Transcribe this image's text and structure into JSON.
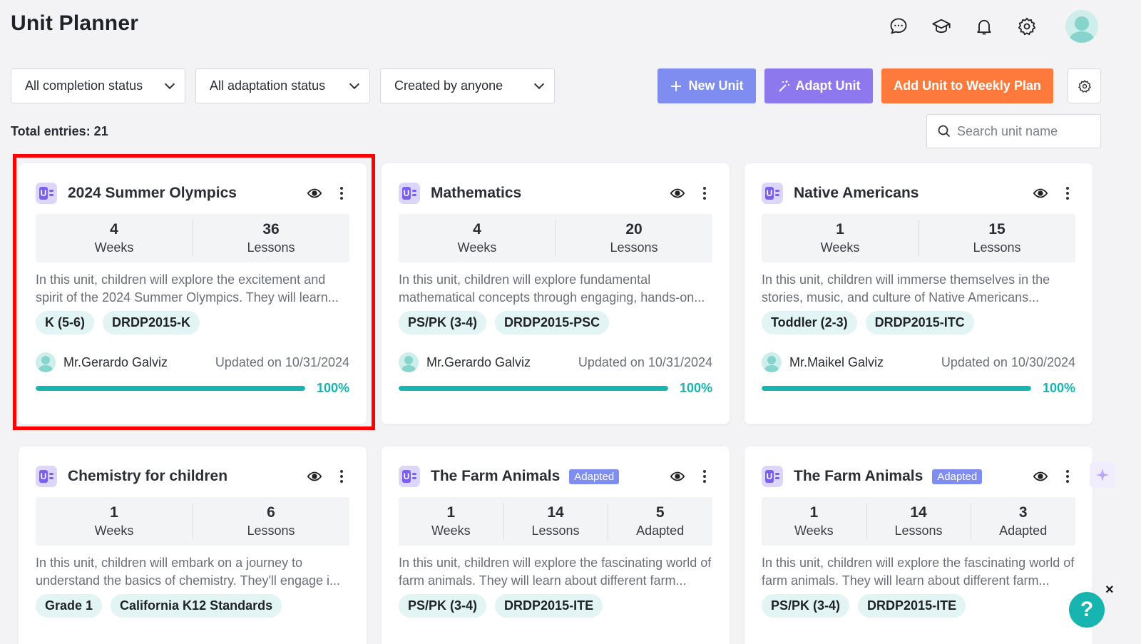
{
  "header": {
    "title": "Unit Planner"
  },
  "filters": {
    "completion": "All completion status",
    "adaptation": "All adaptation status",
    "creator": "Created by anyone"
  },
  "actions": {
    "new_unit": "New Unit",
    "adapt_unit": "Adapt Unit",
    "add_weekly": "Add Unit to Weekly Plan"
  },
  "total": "Total entries: 21",
  "search": {
    "placeholder": "Search unit name"
  },
  "colors": {
    "teal": "#19b3b0",
    "new_unit": "#7f8cf0",
    "adapt": "#8d78ee",
    "weekly": "#fd7a3c",
    "highlight": "#ff0000"
  },
  "cards": [
    {
      "title": "2024 Summer Olympics",
      "stats": [
        {
          "num": "4",
          "label": "Weeks"
        },
        {
          "num": "36",
          "label": "Lessons"
        }
      ],
      "description": "In this unit, children will explore the excitement and spirit of the 2024 Summer Olympics. They will learn...",
      "tags": [
        "K (5-6)",
        "DRDP2015-K"
      ],
      "author": "Mr.Gerardo Galviz",
      "updated": "Updated on 10/31/2024",
      "progress": 1.0,
      "progress_label": "100%"
    },
    {
      "title": "Mathematics",
      "stats": [
        {
          "num": "4",
          "label": "Weeks"
        },
        {
          "num": "20",
          "label": "Lessons"
        }
      ],
      "description": "In this unit, children will explore fundamental mathematical concepts through engaging, hands-on...",
      "tags": [
        "PS/PK (3-4)",
        "DRDP2015-PSC"
      ],
      "author": "Mr.Gerardo Galviz",
      "updated": "Updated on 10/31/2024",
      "progress": 1.0,
      "progress_label": "100%"
    },
    {
      "title": "Native Americans",
      "stats": [
        {
          "num": "1",
          "label": "Weeks"
        },
        {
          "num": "15",
          "label": "Lessons"
        }
      ],
      "description": "In this unit, children will immerse themselves in the stories, music, and culture of Native Americans...",
      "tags": [
        "Toddler (2-3)",
        "DRDP2015-ITC"
      ],
      "author": "Mr.Maikel Galviz",
      "updated": "Updated on 10/30/2024",
      "progress": 1.0,
      "progress_label": "100%"
    },
    {
      "title": "Chemistry for children",
      "stats": [
        {
          "num": "1",
          "label": "Weeks"
        },
        {
          "num": "6",
          "label": "Lessons"
        }
      ],
      "description": "In this unit, children will embark on a journey to understand the basics of chemistry. They'll engage i...",
      "tags": [
        "Grade 1",
        "California K12 Standards"
      ]
    },
    {
      "title": "The Farm Animals",
      "badge": "Adapted",
      "stats": [
        {
          "num": "1",
          "label": "Weeks"
        },
        {
          "num": "14",
          "label": "Lessons"
        },
        {
          "num": "5",
          "label": "Adapted"
        }
      ],
      "description": "In this unit, children will explore the fascinating world of farm animals. They will learn about different farm...",
      "tags": [
        "PS/PK (3-4)",
        "DRDP2015-ITE"
      ]
    },
    {
      "title": "The Farm Animals",
      "badge": "Adapted",
      "stats": [
        {
          "num": "1",
          "label": "Weeks"
        },
        {
          "num": "14",
          "label": "Lessons"
        },
        {
          "num": "3",
          "label": "Adapted"
        }
      ],
      "description": "In this unit, children will explore the fascinating world of farm animals. They will learn about different farm...",
      "tags": [
        "PS/PK (3-4)",
        "DRDP2015-ITE"
      ]
    }
  ],
  "help": {
    "label": "?",
    "close": "×"
  }
}
